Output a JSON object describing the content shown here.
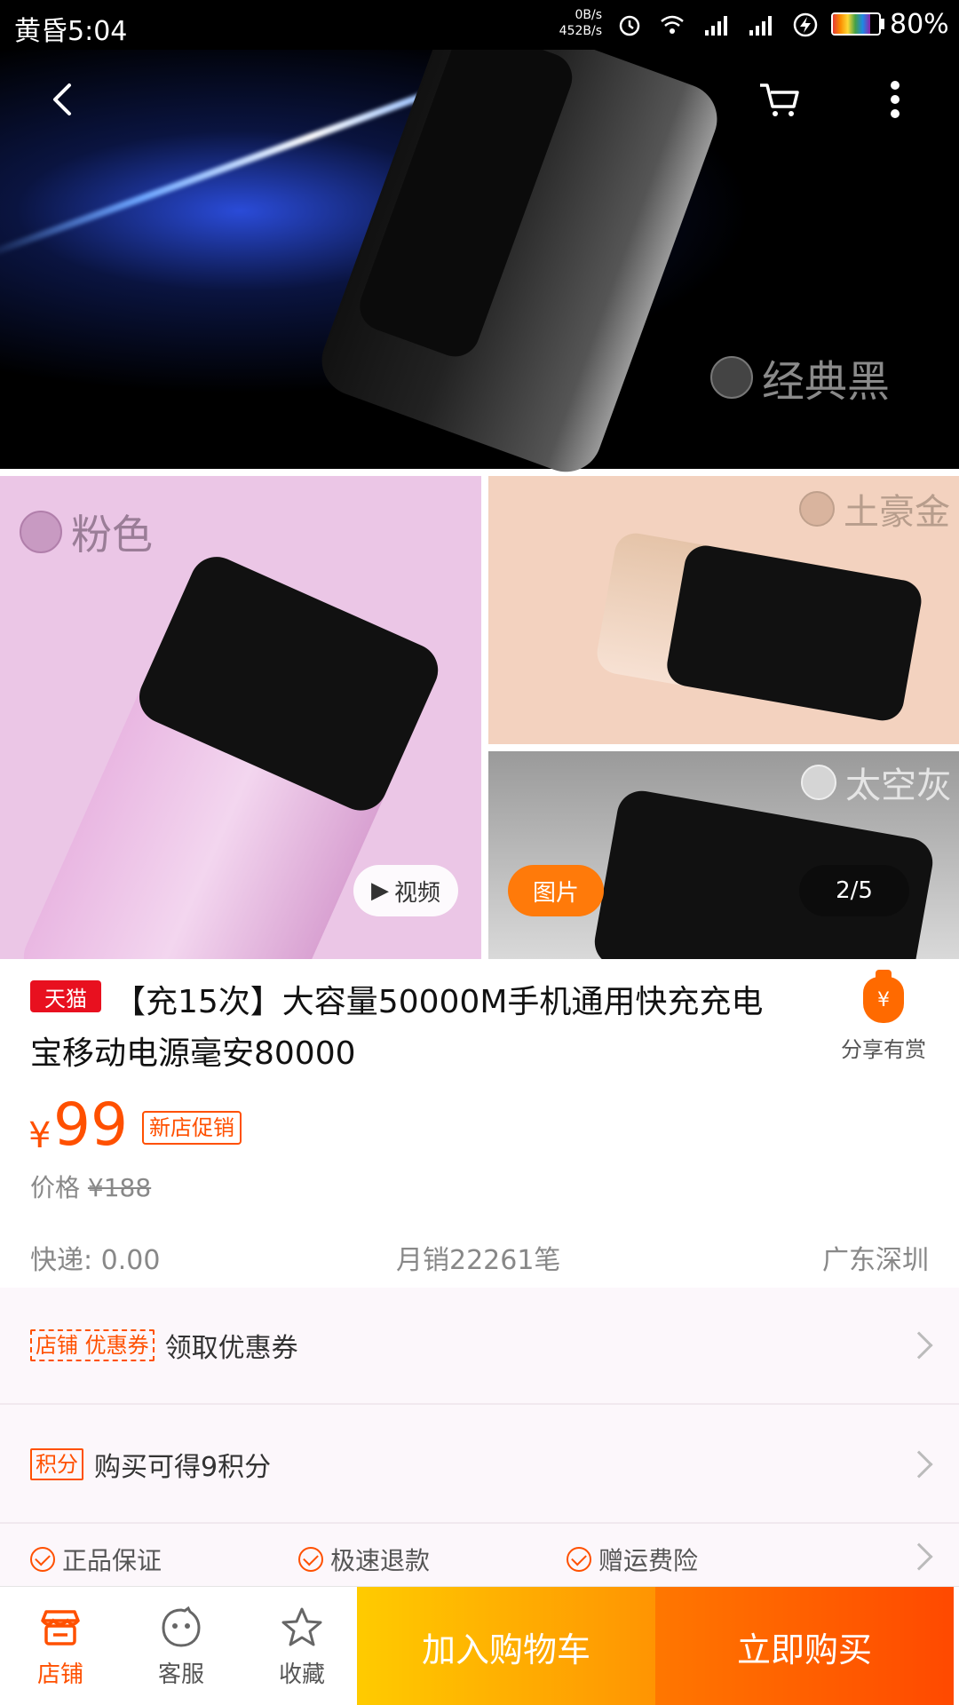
{
  "status_bar": {
    "time": "黄昏5:04",
    "net_up": "0B/s",
    "net_down": "452B/s",
    "battery_percent": "80%",
    "battery_level": 0.8
  },
  "gallery": {
    "color_labels": {
      "black": "经典黑",
      "pink": "粉色",
      "gold": "土豪金",
      "gray": "太空灰"
    },
    "video_label": "视频",
    "image_label": "图片",
    "counter": "2/5"
  },
  "product": {
    "badge": "天猫",
    "title": "【充15次】大容量50000M手机通用快充充电宝移动电源毫安80000",
    "share_label": "分享有赏",
    "currency": "¥",
    "price": "99",
    "promo_tag": "新店促销",
    "original_label": "价格",
    "original_price": "¥188",
    "shipping": "快递: 0.00",
    "monthly_sales": "月销22261笔",
    "location": "广东深圳"
  },
  "rows": {
    "coupon_tag": "店铺 优惠券",
    "coupon_text": "领取优惠券",
    "points_tag": "积分",
    "points_text": "购买可得9积分",
    "guarantees": [
      "正品保证",
      "极速退款",
      "赠运费险"
    ]
  },
  "bottom_bar": {
    "shop": "店铺",
    "service": "客服",
    "favorite": "收藏",
    "add_to_cart": "加入购物车",
    "buy_now": "立即购买"
  },
  "colors": {
    "accent": "#ff5000",
    "tmall_red": "#e8101f",
    "cart_yellow": "#ffcb00",
    "buy_orange": "#ff4900"
  }
}
